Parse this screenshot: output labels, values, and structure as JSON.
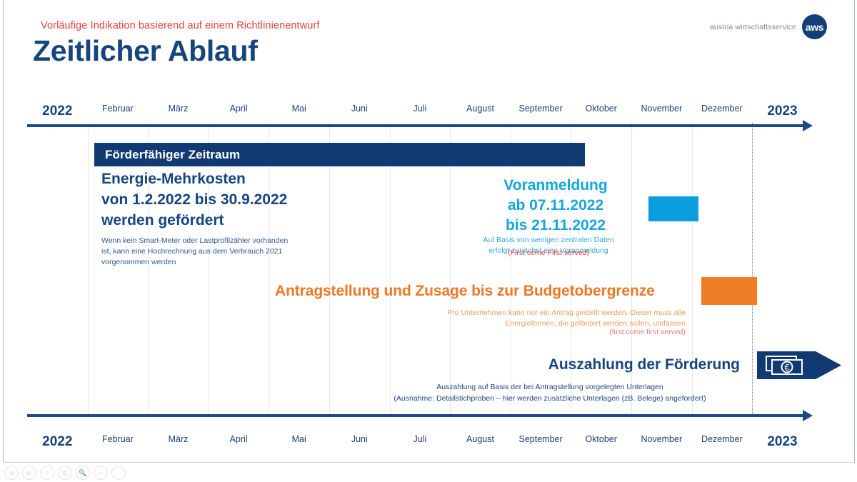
{
  "header": {
    "kicker": "Vorläufige Indikation basierend auf einem Richtlinienentwurf",
    "title": "Zeitlicher Ablauf"
  },
  "logo": {
    "wordmark": "austria wirtschaftsservice",
    "mark": "aws"
  },
  "colors": {
    "dark_blue": "#123a72",
    "title_blue": "#16457e",
    "cyan": "#0b9ddd",
    "orange": "#ef7d24",
    "red": "#e8403a",
    "gridline": "#e2e8f0"
  },
  "chart_data": {
    "type": "bar",
    "title": "Zeitlicher Ablauf",
    "orientation": "horizontal-timeline",
    "xlabel": "",
    "ylabel": "",
    "grid": true,
    "legend": "none",
    "categories": [
      "2022",
      "Februar",
      "März",
      "April",
      "Mai",
      "Juni",
      "Juli",
      "August",
      "September",
      "Oktober",
      "November",
      "Dezember",
      "2023"
    ],
    "axis_top_labels": [
      "2022",
      "Februar",
      "März",
      "April",
      "Mai",
      "Juni",
      "Juli",
      "August",
      "September",
      "Oktober",
      "November",
      "Dezember",
      "2023"
    ],
    "axis_bottom_labels": [
      "2022",
      "Februar",
      "März",
      "April",
      "Mai",
      "Juni",
      "Juli",
      "August",
      "September",
      "Oktober",
      "November",
      "Dezember",
      "2023"
    ],
    "year_divider_after": "Dezember",
    "series": [
      {
        "name": "Förderfähiger Zeitraum",
        "color": "#123a72",
        "start": "Februar",
        "end": "September",
        "start_index": 1,
        "end_index": 9
      },
      {
        "name": "Voranmeldung",
        "color": "#0b9ddd",
        "start": "November",
        "end": "November",
        "start_index": 10,
        "end_index": 10.8
      },
      {
        "name": "Antragstellung und Zusage",
        "color": "#ef7d24",
        "start": "Dezember",
        "end": "Dezember",
        "start_index": 11,
        "end_index": 11.9
      },
      {
        "name": "Auszahlung der Förderung",
        "color": "#123a72",
        "start": "2023",
        "end": "2023",
        "start_index": 12,
        "end_index": 13
      }
    ]
  },
  "bars": {
    "foerderfaehig_label": "Förderfähiger Zeitraum"
  },
  "blocks": {
    "energie": {
      "heading": "Energie-Mehrkosten\nvon 1.2.2022 bis 30.9.2022\nwerden gefördert",
      "note": "Wenn kein Smart-Meter oder Lastprofilzähler vorhanden\nist, kann eine Hochrechnung aus dem Verbrauch 2021\nvorgenommen werden"
    },
    "voranmeldung": {
      "heading": "Voranmeldung\nab 07.11.2022\nbis 21.11.2022",
      "note": "Auf Basis von wenigen zentralen Daten\nerfolgt zunächst eine Voranmeldung",
      "fcfs": "(First come First served)"
    },
    "antragstellung": {
      "heading": "Antragstellung und Zusage bis zur Budgetobergrenze",
      "note": "Pro Unternehmen kann nur ein Antrag gestellt werden. Dieser muss alle\nEnergieformen, die gefördert werden sollen, umfassen",
      "fcfs": "(first come first served)"
    },
    "auszahlung": {
      "heading": "Auszahlung der Förderung",
      "note": "Auszahlung auf Basis der bei Antragstellung vorgelegten Unterlagen\n(Ausnahme: Detailstichproben – hier werden zusätzliche Unterlagen (zB. Belege) angefordert)"
    }
  },
  "toolbar": {
    "buttons": [
      {
        "name": "previous-slide",
        "glyph": "◀"
      },
      {
        "name": "next-slide",
        "glyph": "▶"
      },
      {
        "name": "pen-tool",
        "glyph": "✎"
      },
      {
        "name": "grid-view",
        "glyph": "▦"
      },
      {
        "name": "zoom-tool",
        "glyph": "🔍"
      },
      {
        "name": "presenter-view",
        "glyph": "▭"
      },
      {
        "name": "more-options",
        "glyph": "⋯"
      }
    ]
  }
}
